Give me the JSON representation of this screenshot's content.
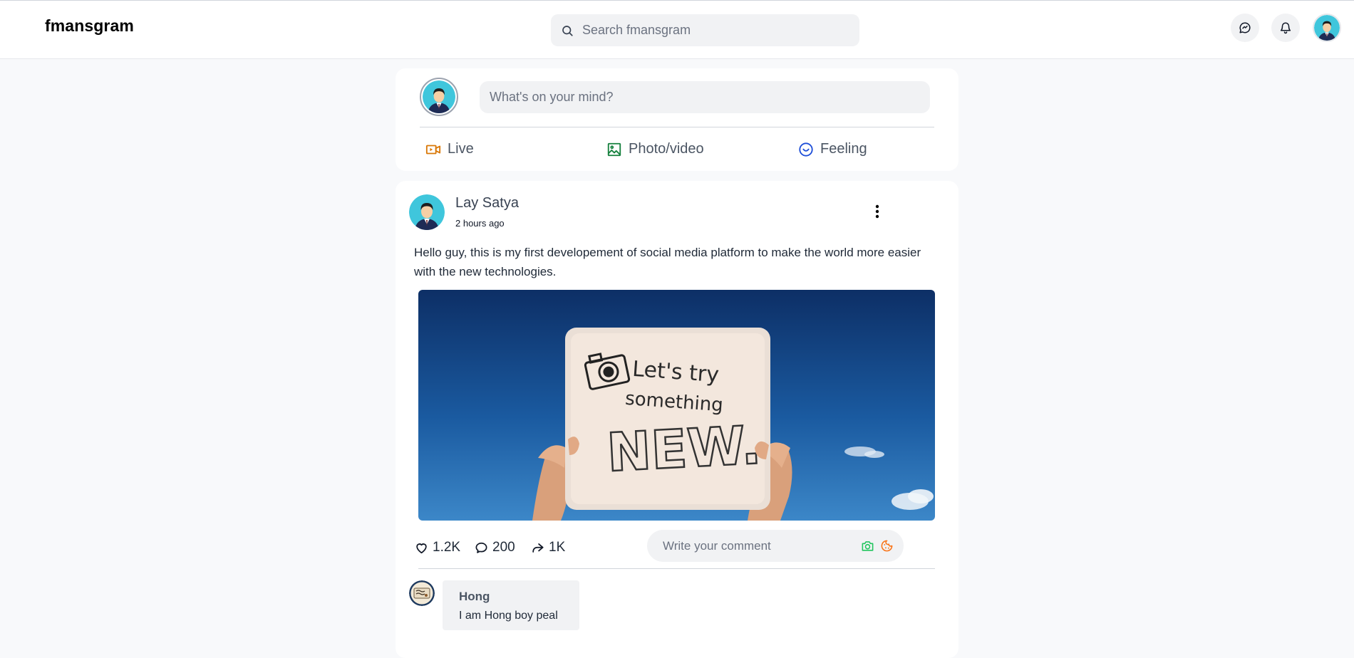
{
  "header": {
    "logo": "fmansgram",
    "search_placeholder": "Search fmansgram",
    "icons": [
      "messenger-icon",
      "bell-icon",
      "profile-avatar"
    ]
  },
  "composer": {
    "placeholder": "What's on your mind?",
    "actions": [
      {
        "label": "Live",
        "icon": "video-icon",
        "color": "#d97706"
      },
      {
        "label": "Photo/video",
        "icon": "image-icon",
        "color": "#15803d"
      },
      {
        "label": "Feeling",
        "icon": "smile-icon",
        "color": "#1d4ed8"
      }
    ]
  },
  "post": {
    "author": "Lay Satya",
    "time": "2 hours ago",
    "text": "Hello guy, this is my first developement of social media platform to make the world more easier with the new technologies.",
    "image_sign_text": [
      "Let's try",
      "something",
      "NEW."
    ],
    "stats": {
      "likes": "1.2K",
      "comments": "200",
      "shares": "1K"
    },
    "comment_placeholder": "Write your comment",
    "comment": {
      "name": "Hong",
      "text": "I am Hong boy peal"
    }
  },
  "colors": {
    "page_bg": "#f8f9fb",
    "card_bg": "#ffffff",
    "input_bg": "#f1f2f4",
    "live": "#d97706",
    "photo": "#15803d",
    "feeling": "#1d4ed8",
    "camera": "#22c55e",
    "sticker": "#f97316"
  }
}
